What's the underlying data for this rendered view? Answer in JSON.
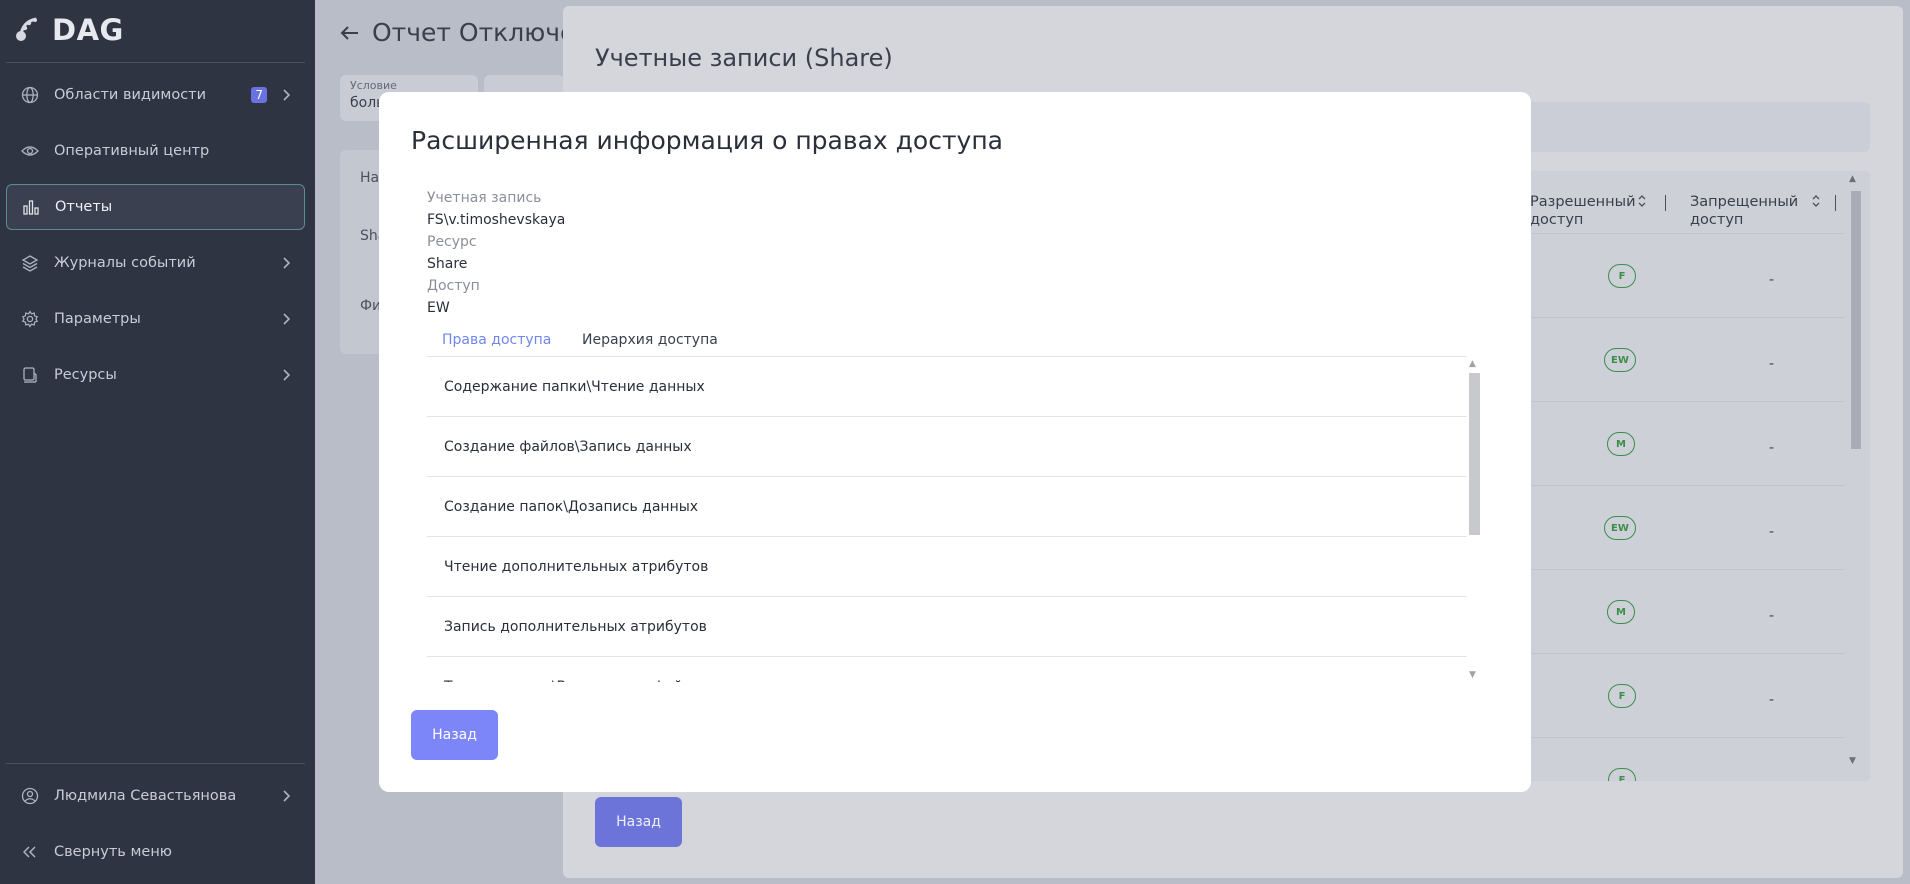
{
  "app": {
    "logo_text": "DAG"
  },
  "sidebar": {
    "items": [
      {
        "label": "Области видимости",
        "badge": "7",
        "icon": "globe-icon",
        "has_chevron": true
      },
      {
        "label": "Оперативный центр",
        "icon": "eye-icon",
        "has_chevron": false
      },
      {
        "label": "Отчеты",
        "icon": "bar-chart-icon",
        "has_chevron": false,
        "active": true
      },
      {
        "label": "Журналы событий",
        "icon": "layers-icon",
        "has_chevron": true
      },
      {
        "label": "Параметры",
        "icon": "gear-icon",
        "has_chevron": true
      },
      {
        "label": "Ресурсы",
        "icon": "server-icon",
        "has_chevron": true
      }
    ],
    "user_name": "Людмила Севастьянова",
    "collapse_label": "Свернуть меню"
  },
  "background": {
    "title": "Отчет Отключе",
    "filter": {
      "label": "Условие",
      "value": "боль"
    },
    "table_cells": [
      "На",
      "Sha",
      "Фи"
    ]
  },
  "panel2": {
    "title": "Учетные записи (Share)",
    "columns": {
      "allowed": [
        "Разрешенный",
        "доступ"
      ],
      "denied": [
        "Запрещенный",
        "доступ"
      ]
    },
    "rows": [
      {
        "allowed": "F",
        "denied": "-"
      },
      {
        "allowed": "EW",
        "denied": "-"
      },
      {
        "allowed": "M",
        "denied": "-"
      },
      {
        "allowed": "EW",
        "denied": "-"
      },
      {
        "allowed": "M",
        "denied": "-"
      },
      {
        "allowed": "F",
        "denied": "-"
      },
      {
        "allowed": "F",
        "denied": ""
      }
    ],
    "back_label": "Назад"
  },
  "modal": {
    "title": "Расширенная информация о правах доступа",
    "account_label": "Учетная запись",
    "account_value": "FS\\v.timoshevskaya",
    "resource_label": "Ресурс",
    "resource_value": "Share",
    "access_label": "Доступ",
    "access_value": "EW",
    "tabs": [
      "Права доступа",
      "Иерархия доступа"
    ],
    "rights": [
      "Содержание папки\\Чтение данных",
      "Создание файлов\\Запись данных",
      "Создание папок\\Дозапись данных",
      "Чтение дополнительных атрибутов",
      "Запись дополнительных атрибутов",
      "Траверс папок\\Выполнение файлов"
    ],
    "back_label": "Назад"
  },
  "colors": {
    "sidebar_bg": "#2f3442",
    "accent": "#7d86f8",
    "tab_active": "#6f86ee",
    "chip_green": "#3a8f4a"
  }
}
